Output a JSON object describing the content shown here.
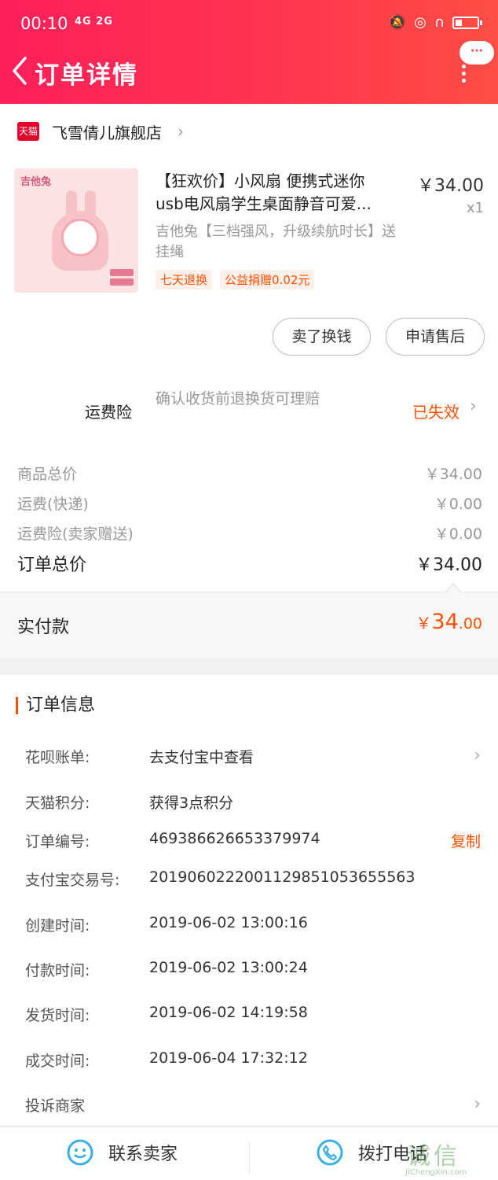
{
  "status_bar": {
    "time": "00:10",
    "network": "4G 2G"
  },
  "header": {
    "title": "订单详情",
    "more_label": "···"
  },
  "shop": {
    "logo_text": "天猫",
    "name": "飞雪倩儿旗舰店"
  },
  "product": {
    "title_line1": "【狂欢价】小风扇 便携式迷你",
    "title_line2": "usb电风扇学生桌面静音可爱...",
    "price": "￥34.00",
    "qty": "x1",
    "sku": "吉他兔【三档强风，升级续航时长】送挂绳",
    "image_brand": "吉他兔",
    "tags": [
      "七天退换",
      "公益捐赠0.02元"
    ]
  },
  "actions": {
    "sell": "卖了换钱",
    "after_sale": "申请售后"
  },
  "insurance": {
    "label": "运费险",
    "desc": "确认收货前退换货可理赔",
    "status": "已失效"
  },
  "fees": [
    {
      "label": "商品总价",
      "value": "￥34.00"
    },
    {
      "label": "运费(快递)",
      "value": "￥0.00"
    },
    {
      "label": "运费险(卖家赠送)",
      "value": "￥0.00"
    }
  ],
  "total": {
    "label": "订单总价",
    "value": "￥34.00"
  },
  "paid": {
    "label": "实付款",
    "currency": "￥",
    "integer": "34",
    "decimal": ".00"
  },
  "order_info": {
    "heading": "订单信息",
    "rows": [
      {
        "key": "花呗账单:",
        "value": "去支付宝中查看"
      },
      {
        "key": "天猫积分:",
        "value": "获得3点积分"
      },
      {
        "key": "订单编号:",
        "value": "469386626653379974",
        "action": "复制"
      },
      {
        "key": "支付宝交易号:",
        "value": "2019060222001129851053655563"
      },
      {
        "key": "创建时间:",
        "value": "2019-06-02 13:00:16"
      },
      {
        "key": "付款时间:",
        "value": "2019-06-02 13:00:24"
      },
      {
        "key": "发货时间:",
        "value": "2019-06-02 14:19:58"
      },
      {
        "key": "成交时间:",
        "value": "2019-06-04 17:32:12"
      },
      {
        "key": "投诉商家",
        "value": ""
      }
    ]
  },
  "bottom_bar": {
    "contact": "联系卖家",
    "call": "拨打电话"
  },
  "watermark": {
    "cn": "诚信",
    "en": "JiChengXin.com"
  },
  "colors": {
    "header_start": "#ff1f5a",
    "header_end": "#ff4d44",
    "accent": "#ff5000"
  }
}
